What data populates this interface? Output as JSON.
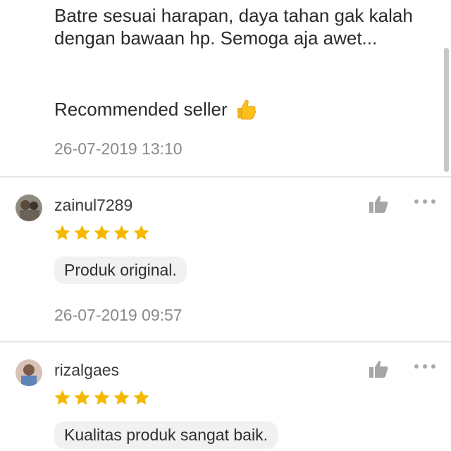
{
  "top_review": {
    "text": "Batre sesuai harapan, daya tahan gak kalah dengan bawaan hp. Semoga aja awet...",
    "recommendation": "Recommended seller",
    "timestamp": "26-07-2019 13:10"
  },
  "reviews": [
    {
      "username": "zainul7289",
      "rating": 5,
      "tag": "Produk original.",
      "timestamp": "26-07-2019 09:57",
      "avatar_icon": "user-avatar"
    },
    {
      "username": "rizalgaes",
      "rating": 5,
      "tag": "Kualitas produk sangat baik.",
      "avatar_icon": "user-avatar"
    }
  ],
  "colors": {
    "star": "#f5b800",
    "like_icon": "#a6a6a6",
    "divider": "#e7e7e7",
    "timestamp": "#8a8a8a"
  }
}
